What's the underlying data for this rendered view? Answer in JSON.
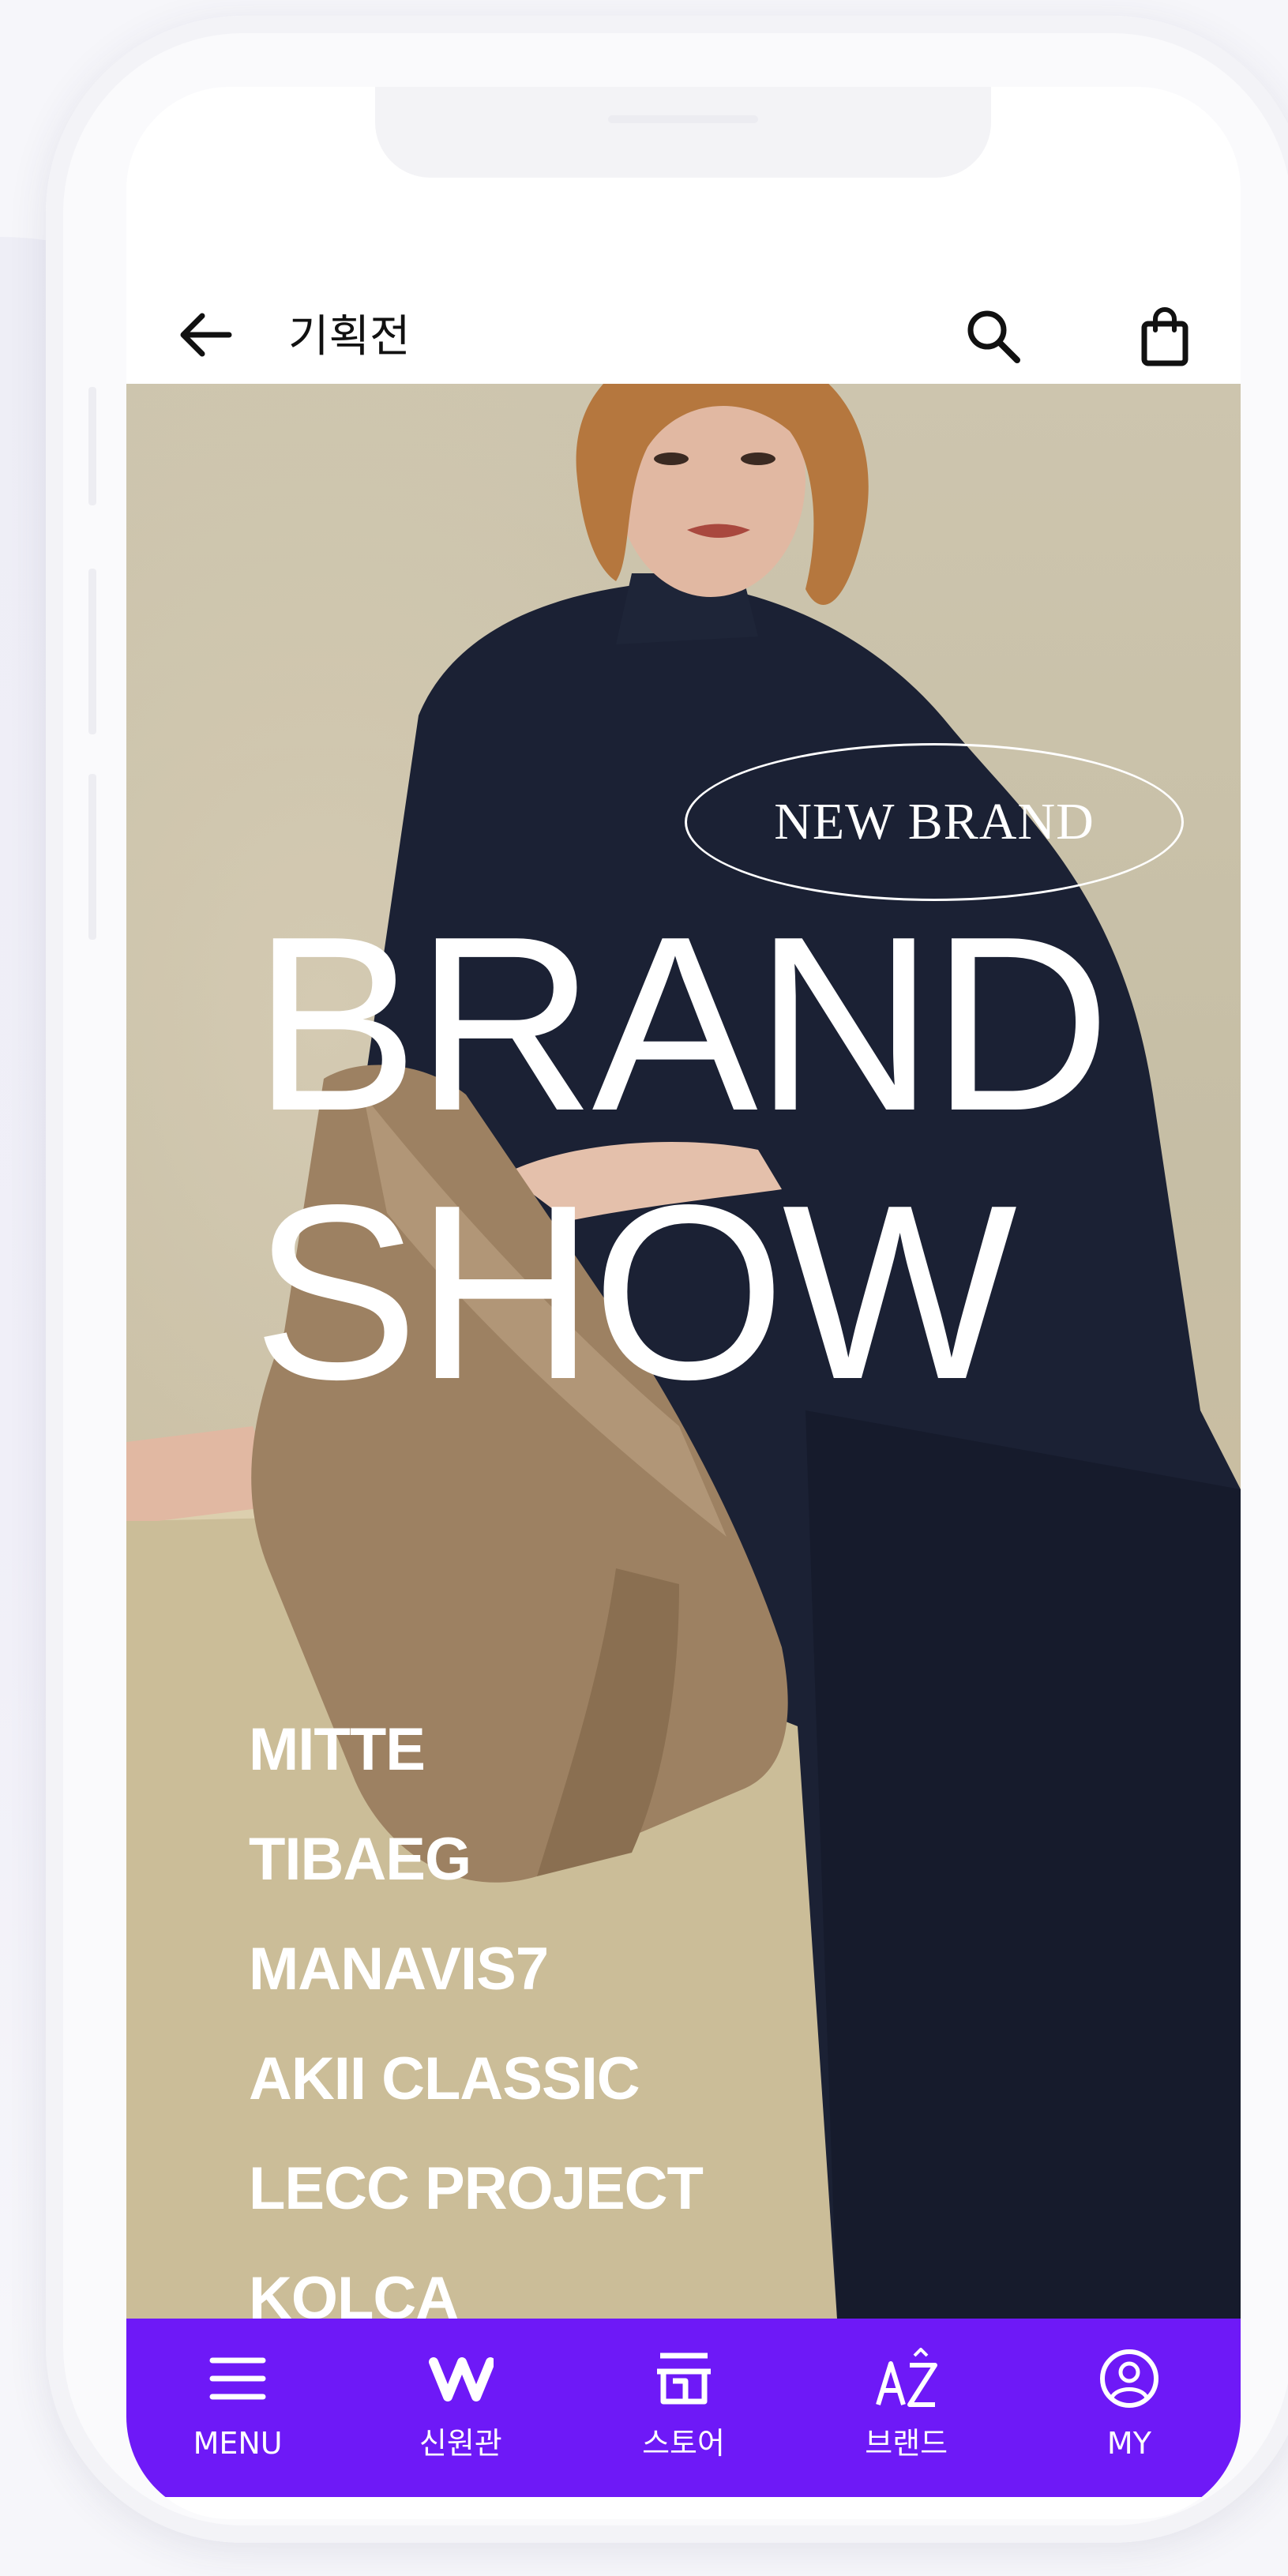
{
  "header": {
    "title": "기획전",
    "back_icon": "arrow-left-icon",
    "search_icon": "search-icon",
    "cart_icon": "shopping-bag-icon"
  },
  "hero": {
    "badge": "NEW BRAND",
    "headline_line1": "BRAND",
    "headline_line2": "SHOW",
    "brands": [
      "MITTE",
      "TIBAEG",
      "MANAVIS7",
      "AKII CLASSIC",
      "LECC PROJECT",
      "KOLCA"
    ]
  },
  "tabbar": {
    "items": [
      {
        "label": "MENU",
        "icon": "menu-icon"
      },
      {
        "label": "신원관",
        "icon": "shinwon-logo-icon"
      },
      {
        "label": "스토어",
        "icon": "store-icon"
      },
      {
        "label": "브랜드",
        "icon": "az-brand-icon"
      },
      {
        "label": "MY",
        "icon": "user-icon"
      }
    ]
  },
  "colors": {
    "tabbar": "#6e19f7",
    "text_dark": "#111111",
    "hero_text": "#ffffff"
  }
}
